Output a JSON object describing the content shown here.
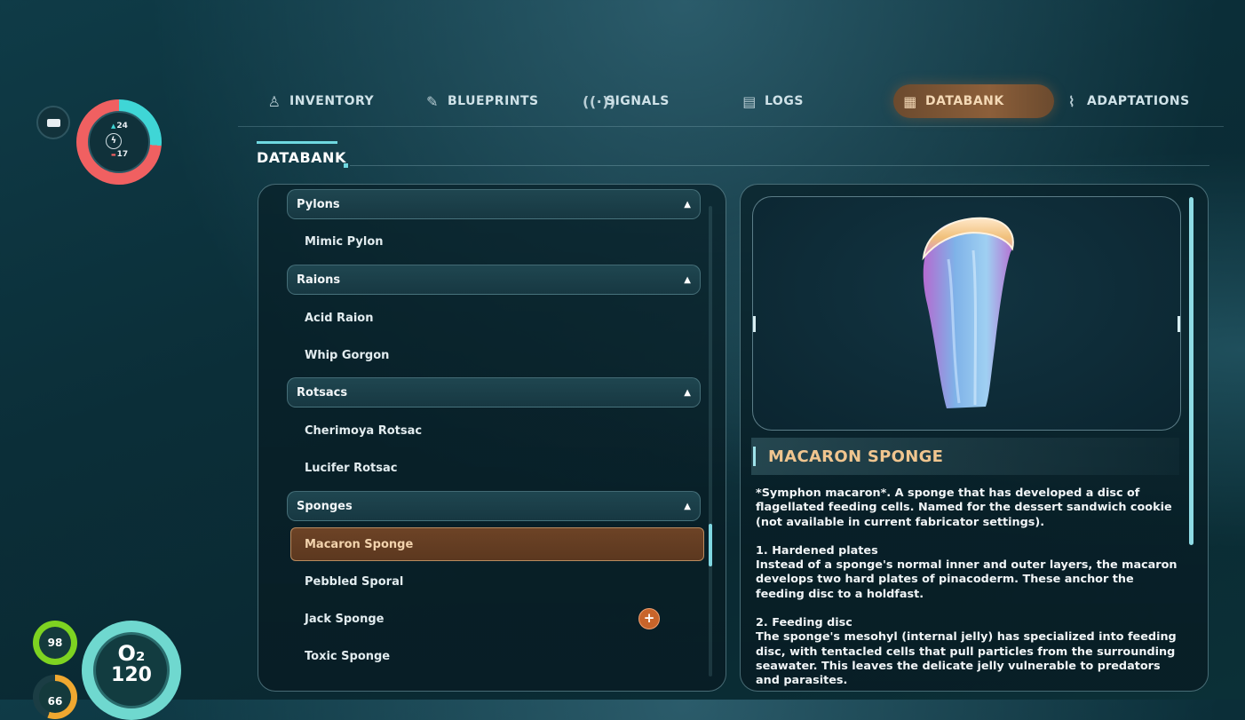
{
  "hud": {
    "power_up": "24",
    "power_down": "17",
    "health": "98",
    "food": "66",
    "oxygen_label": "O₂",
    "oxygen_value": "120"
  },
  "tabs": [
    {
      "label": "INVENTORY",
      "icon": "diver-icon"
    },
    {
      "label": "BLUEPRINTS",
      "icon": "blueprint-icon"
    },
    {
      "label": "SIGNALS",
      "icon": "signal-icon"
    },
    {
      "label": "LOGS",
      "icon": "logs-icon"
    },
    {
      "label": "DATABANK",
      "icon": "databank-icon",
      "active": true
    },
    {
      "label": "ADAPTATIONS",
      "icon": "dna-icon"
    }
  ],
  "section_title": "DATABANK",
  "list": {
    "groups": [
      {
        "label": "Pylons",
        "items": [
          "Mimic Pylon"
        ]
      },
      {
        "label": "Raions",
        "items": [
          "Acid Raion",
          "Whip Gorgon"
        ]
      },
      {
        "label": "Rotsacs",
        "items": [
          "Cherimoya Rotsac",
          "Lucifer Rotsac"
        ]
      },
      {
        "label": "Sponges",
        "items": [
          "Macaron Sponge",
          "Pebbled Sporal",
          "Jack Sponge",
          "Toxic Sponge"
        ]
      }
    ],
    "selected": "Macaron Sponge",
    "new_badge": "+"
  },
  "detail": {
    "title": "MACARON SPONGE",
    "intro": "*Symphon macaron*. A sponge that has developed a disc of flagellated feeding cells. Named for the dessert sandwich cookie (not available in current fabricator settings).",
    "section1": "1. Hardened plates\nInstead of a sponge's normal inner and outer layers, the macaron develops two hard plates of pinacoderm. These anchor the feeding disc to a holdfast.",
    "section2": "2. Feeding disc\nThe sponge's mesohyl (internal jelly) has specialized into feeding disc, with tentacled cells that pull particles from the surrounding seawater. This leaves the delicate jelly vulnerable to predators and parasites."
  },
  "colors": {
    "accent_cyan": "#6fd8e0",
    "active_tab": "#8c5f3a",
    "title_orange": "#f0c58f",
    "health_green": "#7ed321",
    "power_red": "#f06061"
  }
}
